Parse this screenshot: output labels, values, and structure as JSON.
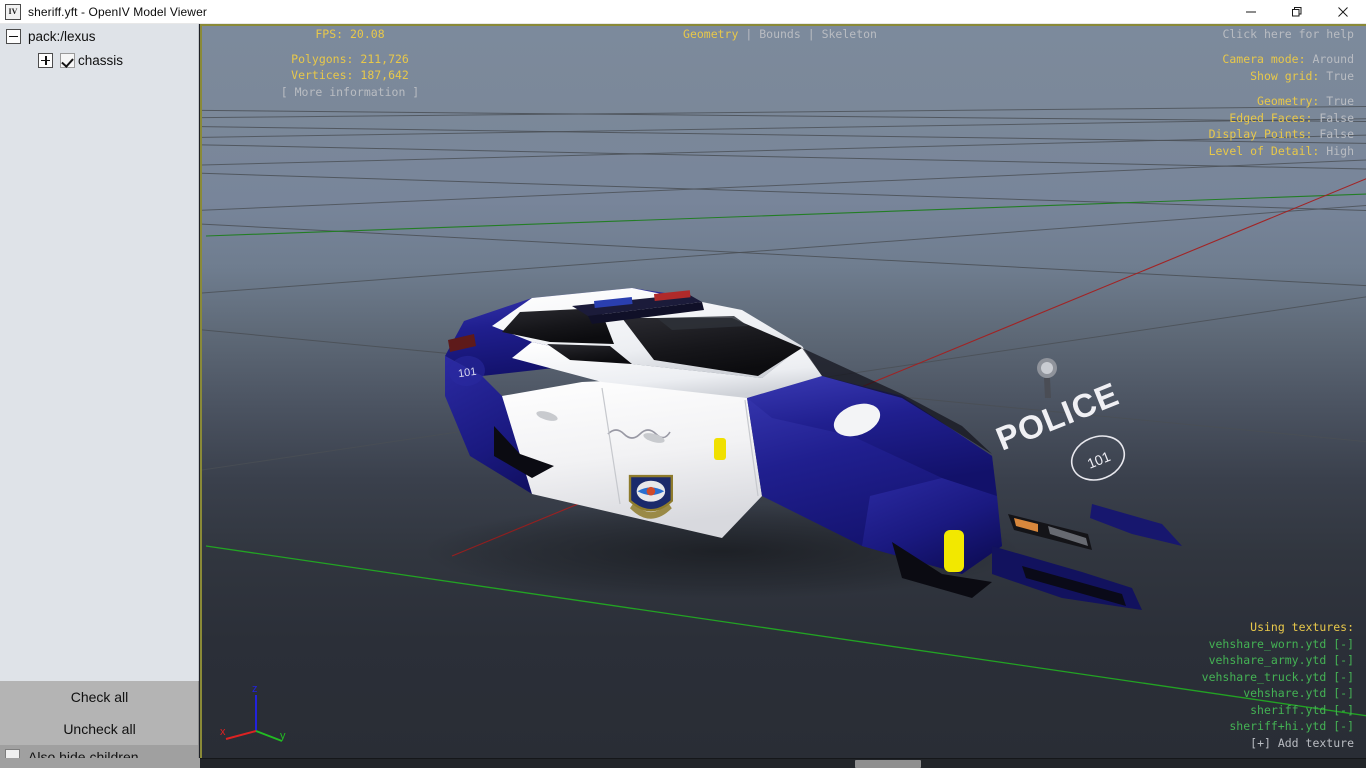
{
  "window": {
    "title": "sheriff.yft - OpenIV Model Viewer",
    "icon_label": "IV",
    "minimize_label": "minimize",
    "restore_label": "restore",
    "close_label": "close"
  },
  "tree": {
    "items": [
      {
        "label": "pack:/lexus",
        "level": 1,
        "expander": "minus",
        "checkbox": null
      },
      {
        "label": "chassis",
        "level": 2,
        "expander": "plus",
        "checkbox": "checked"
      }
    ]
  },
  "tree_actions": {
    "check_all": "Check all",
    "uncheck_all": "Uncheck all",
    "hide_children": "Also hide children"
  },
  "hud": {
    "stats": {
      "fps_label": "FPS:",
      "fps_value": "20.08",
      "polygons_label": "Polygons:",
      "polygons_value": "211,726",
      "vertices_label": "Vertices:",
      "vertices_value": "187,642",
      "more_information": "[ More information ]"
    },
    "tabs": [
      {
        "label": "Geometry",
        "active": true
      },
      {
        "label": "Bounds",
        "active": false
      },
      {
        "label": "Skeleton",
        "active": false
      }
    ],
    "tab_separator": "|",
    "help_link": "Click here for help",
    "view_settings": [
      {
        "label": "Camera mode:",
        "value": "Around"
      },
      {
        "label": "Show grid:",
        "value": "True"
      }
    ],
    "render_settings": [
      {
        "label": "Geometry:",
        "value": "True"
      },
      {
        "label": "Edged Faces:",
        "value": "False"
      },
      {
        "label": "Display Points:",
        "value": "False"
      },
      {
        "label": "Level of Detail:",
        "value": "High"
      }
    ],
    "textures": {
      "header": "Using textures:",
      "items": [
        {
          "name": "vehshare_worn.ytd",
          "toggle": "[-]"
        },
        {
          "name": "vehshare_army.ytd",
          "toggle": "[-]"
        },
        {
          "name": "vehshare_truck.ytd",
          "toggle": "[-]"
        },
        {
          "name": "vehshare.ytd",
          "toggle": "[-]"
        },
        {
          "name": "sheriff.ytd",
          "toggle": "[-]"
        },
        {
          "name": "sheriff+hi.ytd",
          "toggle": "[-]"
        }
      ],
      "add_texture": "[+] Add texture"
    },
    "axis_gizmo": {
      "x": "x",
      "y": "y",
      "z": "z"
    }
  },
  "model": {
    "body_text": "POLICE",
    "unit_number": "101",
    "body_color": "#1c1c8c",
    "accent_color": "#f2f2f2"
  },
  "colors": {
    "hud_label": "#e8c84a",
    "hud_value": "#b9bcc2",
    "texture_name": "#44b254",
    "viewport_border": "#8a8a37",
    "axis_x": "#cc2222",
    "axis_y": "#22aa22",
    "axis_z": "#2222cc"
  }
}
